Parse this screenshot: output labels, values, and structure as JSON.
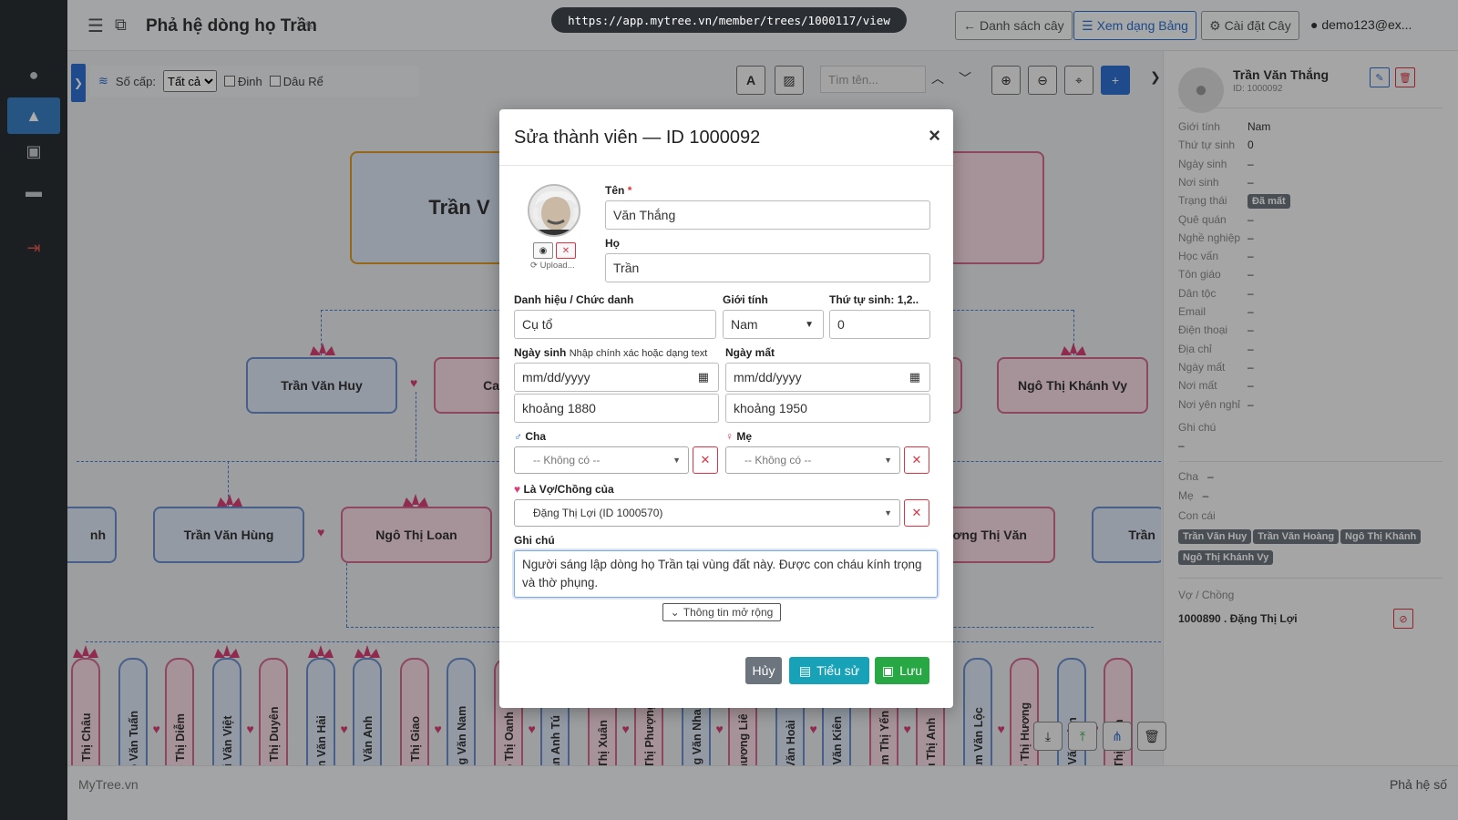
{
  "url": "https://app.mytree.vn/member/trees/1000117/view",
  "header": {
    "title": "Phả hệ dòng họ Trần",
    "buttons": {
      "list": "Danh sách cây",
      "table": "Xem dạng Bảng",
      "settings": "Cài đặt Cây"
    },
    "user": "demo123@ex..."
  },
  "toolbar": {
    "level_label": "Số cấp:",
    "level_value": "Tất cả",
    "chk_dinh": "Đinh",
    "chk_daure": "Dâu Rể",
    "search_placeholder": "Tìm tên...",
    "font_btn": "A"
  },
  "tree": {
    "top_node": "Trần V",
    "gen2": [
      "Trần Văn Huy",
      "Ca",
      "Ngô Thị Khánh Vy"
    ],
    "gen3": [
      "nh",
      "Trần Văn Hùng",
      "Ngô Thị Loan",
      "Vương Thị Văn",
      "Trần"
    ],
    "gen4": [
      "ao Thị Châu",
      "gô Văn Tuấn",
      "ao Thị Diễm",
      "Vũ Văn Việt",
      "ao Thị Duyên",
      "rần Văn Hải",
      "ần Văn Anh",
      "ao Thị Giao",
      "ãng Văn Nam",
      "gô Thị Oanh",
      "Văn Anh Tú",
      "ô Thị Xuân",
      "ô Thị Phượng",
      "ăng Văn Nha",
      "Phương Liê",
      "ạ Văn Hoài",
      "ùi Văn Kiên",
      "nam Thị Yến",
      "ưu Thị Anh",
      "nam Văn Lộc",
      "gô Thị Hương",
      "ùi Văn Lâm",
      "ô Thị Nhàn"
    ]
  },
  "panel": {
    "name": "Trần Văn Thắng",
    "id": "ID: 1000092",
    "rows": [
      {
        "k": "Giới tính",
        "v": "Nam"
      },
      {
        "k": "Thứ tự sinh",
        "v": "0"
      },
      {
        "k": "Ngày sinh",
        "v": "–"
      },
      {
        "k": "Nơi sinh",
        "v": "–"
      },
      {
        "k": "Trạng thái",
        "v": "Đã mất"
      },
      {
        "k": "Quê quán",
        "v": "–"
      },
      {
        "k": "Nghề nghiệp",
        "v": "–"
      },
      {
        "k": "Học vấn",
        "v": "–"
      },
      {
        "k": "Tôn giáo",
        "v": "–"
      },
      {
        "k": "Dân tộc",
        "v": "–"
      },
      {
        "k": "Email",
        "v": "–"
      },
      {
        "k": "Điện thoại",
        "v": "–"
      },
      {
        "k": "Địa chỉ",
        "v": "–"
      },
      {
        "k": "Ngày mất",
        "v": "–"
      },
      {
        "k": "Nơi mất",
        "v": "–"
      },
      {
        "k": "Nơi yên nghỉ",
        "v": "–"
      }
    ],
    "note_label": "Ghi chú",
    "note_value": "–",
    "father_label": "Cha",
    "father_value": "–",
    "mother_label": "Mẹ",
    "mother_value": "–",
    "children_label": "Con cái",
    "children": [
      "Trần Văn Huy",
      "Trần Văn Hoàng",
      "Ngô Thị Khánh",
      "Ngô Thị Khánh Vy"
    ],
    "spouse_label": "Vợ / Chồng",
    "spouse_value": "1000890 . Đặng Thị Lợi"
  },
  "footer": {
    "left": "MyTree.vn",
    "right": "Phả hệ số"
  },
  "modal": {
    "title": "Sửa thành viên — ID 1000092",
    "upload_text": "Upload...",
    "first_name_label": "Tên",
    "first_name": "Văn Thắng",
    "last_name_label": "Họ",
    "last_name": "Trần",
    "title_label": "Danh hiệu / Chức danh",
    "title_value": "Cụ tổ",
    "gender_label": "Giới tính",
    "gender_value": "Nam",
    "order_label": "Thứ tự sinh: 1,2..",
    "order_value": "0",
    "birth_label": "Ngày sinh",
    "birth_hint": "Nhập chính xác hoặc dạng text",
    "birth_date": "mm/dd/yyyy",
    "birth_text": "khoảng 1880",
    "death_label": "Ngày mất",
    "death_date": "mm/dd/yyyy",
    "death_text": "khoảng 1950",
    "father_label": "Cha",
    "father_value": "-- Không có --",
    "mother_label": "Mẹ",
    "mother_value": "-- Không có --",
    "spouse_label": "Là Vợ/Chồng của",
    "spouse_value": "Đặng Thị Lợi (ID 1000570)",
    "note_label": "Ghi chú",
    "note_value": "Người sáng lập dòng họ Trần tại vùng đất này. Được con cháu kính trọng và thờ phụng.",
    "expand_label": "Thông tin mở rộng",
    "cancel": "Hủy",
    "bio": "Tiểu sử",
    "save": "Lưu"
  },
  "colors": {
    "primary": "#2f6fd0",
    "danger": "#dc3545",
    "success": "#28a745",
    "info": "#17a2b8",
    "secondary": "#6c757d",
    "male": "#6c8fcc",
    "female": "#d36a8c"
  }
}
